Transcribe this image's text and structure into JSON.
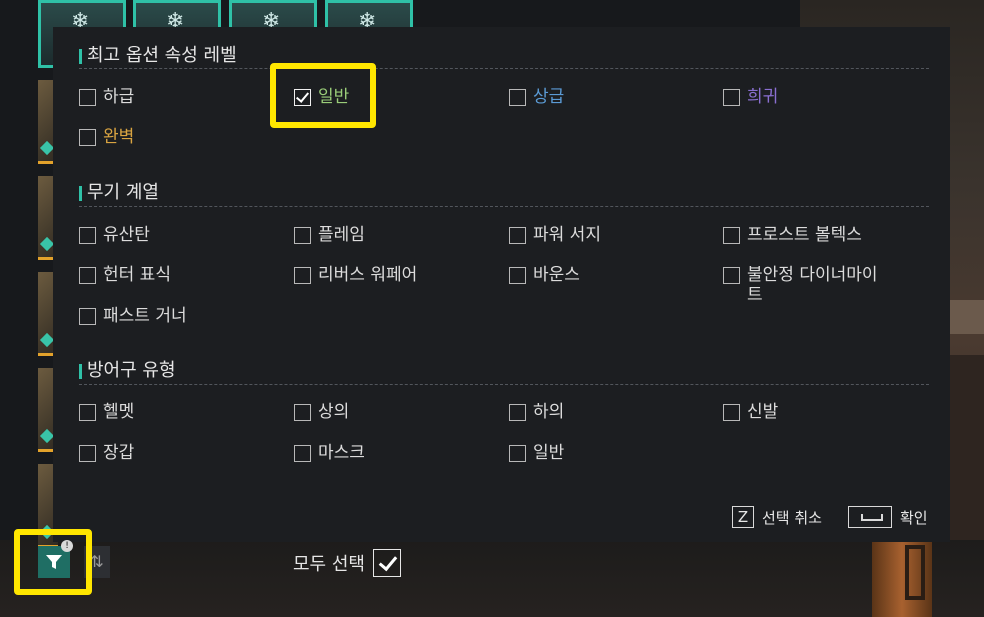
{
  "colors": {
    "accent": "#2fc1a7",
    "highlight": "#ffe600",
    "grade_normal": "#9acd79",
    "grade_advanced": "#5b9bd5",
    "grade_rare": "#8a6fd1",
    "grade_perfect": "#d9a441"
  },
  "panel": {
    "sections": [
      {
        "title": "최고 옵션 속성 레벨",
        "options": [
          {
            "label": "하급",
            "checked": false,
            "color": "#dcdcdc"
          },
          {
            "label": "일반",
            "checked": true,
            "color": "#9acd79"
          },
          {
            "label": "상급",
            "checked": false,
            "color": "#5b9bd5"
          },
          {
            "label": "희귀",
            "checked": false,
            "color": "#8a6fd1"
          },
          {
            "label": "완벽",
            "checked": false,
            "color": "#d9a441"
          }
        ]
      },
      {
        "title": "무기 계열",
        "options": [
          {
            "label": "유산탄",
            "checked": false
          },
          {
            "label": "플레임",
            "checked": false
          },
          {
            "label": "파워 서지",
            "checked": false
          },
          {
            "label": "프로스트 볼텍스",
            "checked": false
          },
          {
            "label": "헌터 표식",
            "checked": false
          },
          {
            "label": "리버스 워페어",
            "checked": false
          },
          {
            "label": "바운스",
            "checked": false
          },
          {
            "label": "불안정 다이너마이트",
            "checked": false
          },
          {
            "label": "패스트 거너",
            "checked": false
          }
        ]
      },
      {
        "title": "방어구 유형",
        "options": [
          {
            "label": "헬멧",
            "checked": false
          },
          {
            "label": "상의",
            "checked": false
          },
          {
            "label": "하의",
            "checked": false
          },
          {
            "label": "신발",
            "checked": false
          },
          {
            "label": "장갑",
            "checked": false
          },
          {
            "label": "마스크",
            "checked": false
          },
          {
            "label": "일반",
            "checked": false
          }
        ]
      }
    ],
    "footer": {
      "cancel_key": "Z",
      "cancel_label": "선택 취소",
      "confirm_key_icon": "spacebar-icon",
      "confirm_label": "확인"
    }
  },
  "bottom_bar": {
    "filter_icon": "filter-funnel-icon",
    "filter_badge": "!",
    "sort_icon": "sort-icon",
    "select_all_label": "모두 선택",
    "select_all_checked": true
  }
}
